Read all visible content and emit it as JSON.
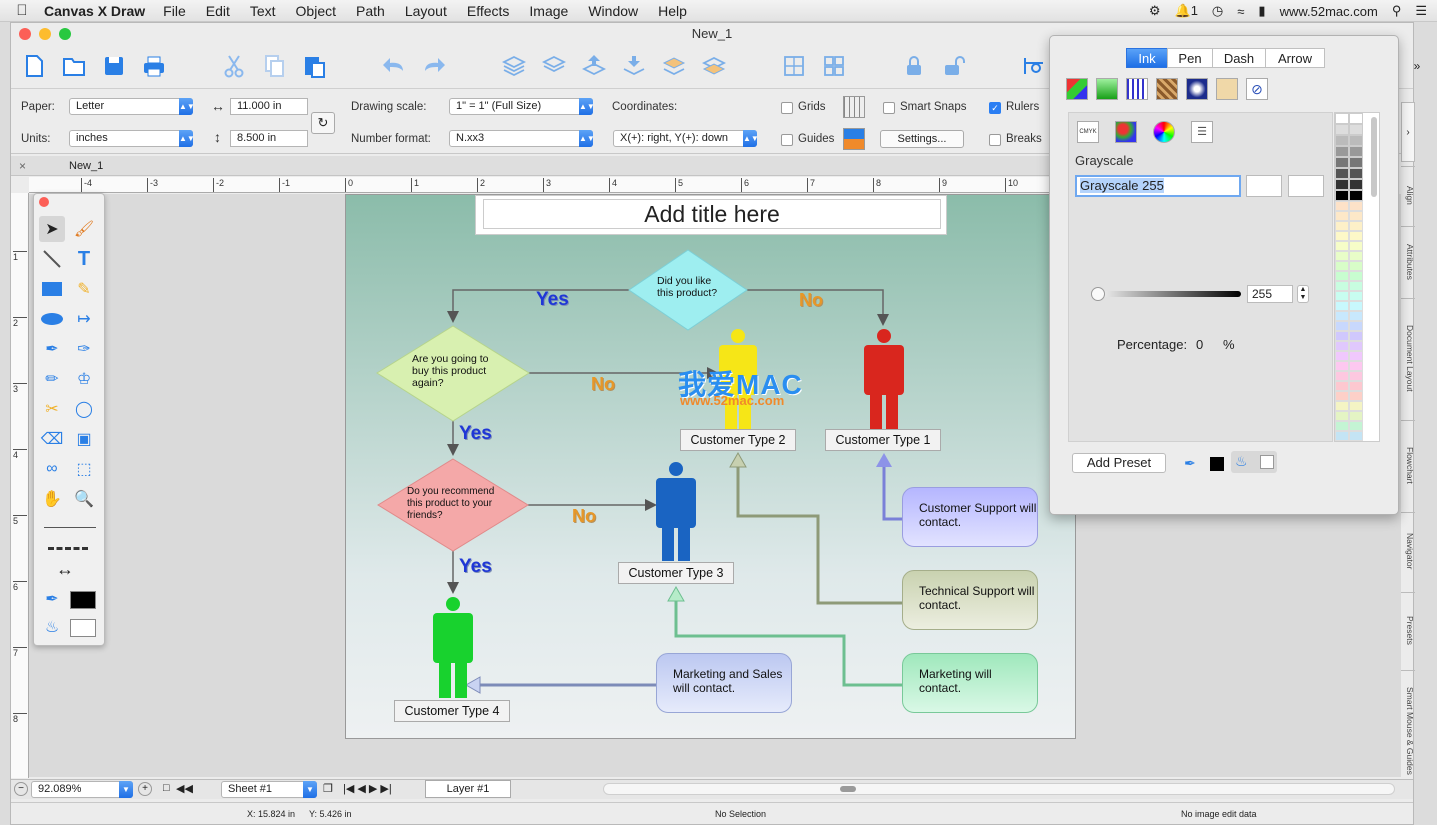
{
  "menubar": {
    "app": "Canvas X Draw",
    "items": [
      "File",
      "Edit",
      "Text",
      "Object",
      "Path",
      "Layout",
      "Effects",
      "Image",
      "Window",
      "Help"
    ],
    "status_right": {
      "notif_count": "1",
      "site": "www.52mac.com"
    }
  },
  "window": {
    "title": "New_1"
  },
  "props": {
    "paper_label": "Paper:",
    "paper_value": "Letter",
    "units_label": "Units:",
    "units_value": "inches",
    "width_value": "11.000 in",
    "height_value": "8.500 in",
    "drawing_scale_label": "Drawing scale:",
    "drawing_scale_value": "1\" = 1\"   (Full Size)",
    "number_format_label": "Number format:",
    "number_format_value": "N.xx3",
    "coordinates_label": "Coordinates:",
    "coordinates_value": "X(+): right, Y(+): down",
    "grids": "Grids",
    "guides": "Guides",
    "smart_snaps": "Smart Snaps",
    "settings": "Settings...",
    "rulers": "Rulers",
    "breaks": "Breaks"
  },
  "doctab": {
    "name": "New_1"
  },
  "ruler_h": [
    "-4",
    "-3",
    "-2",
    "-1",
    "0",
    "1",
    "2",
    "3",
    "4",
    "5",
    "6",
    "7",
    "8",
    "9",
    "10"
  ],
  "ruler_v": [
    "1",
    "2",
    "3",
    "4",
    "5",
    "6",
    "7",
    "8"
  ],
  "diagram": {
    "title": "Add title here",
    "q1": "Did you like this product?",
    "q2": "Are you going to buy this product again?",
    "q3": "Do you recommend this product to your friends?",
    "yes": "Yes",
    "no": "No",
    "ct1": "Customer Type 1",
    "ct2": "Customer Type 2",
    "ct3": "Customer Type 3",
    "ct4": "Customer Type 4",
    "support": "Customer Support will contact.",
    "tech": "Technical Support will contact.",
    "marketing": "Marketing will contact.",
    "sales": "Marketing and Sales will contact.",
    "watermark_cn": "我爱MAC",
    "watermark_url": "www.52mac.com"
  },
  "bottombar": {
    "zoom": "92.089%",
    "sheet": "Sheet #1",
    "layer": "Layer #1"
  },
  "status": {
    "x": "X: 15.824 in",
    "y": "Y: 5.426 in",
    "selection": "No Selection",
    "image": "No image edit data"
  },
  "sidetabs": [
    "Align",
    "Attributes",
    "Document Layout",
    "Flowchart",
    "Navigator",
    "Presets",
    "Smart Mouse & Guides"
  ],
  "inkpanel": {
    "tabs": [
      "Ink",
      "Pen",
      "Dash",
      "Arrow"
    ],
    "active_tab": "Ink",
    "section": "Grayscale",
    "value_field": "Grayscale 255",
    "slider_value": "255",
    "slider_level": 1.0,
    "percentage_label": "Percentage:",
    "percentage_value": "0",
    "percent_sign": "%",
    "add_preset": "Add Preset",
    "mode_labels": [
      "CMYK",
      "RGB",
      "HSB"
    ]
  },
  "colors": {
    "accent": "#1e6fe6",
    "support_box": "#c8c9ff",
    "tech_box": "#d4dcc0",
    "marketing_box": "#b6f0ce",
    "sales_box": "#c9d3f2"
  }
}
